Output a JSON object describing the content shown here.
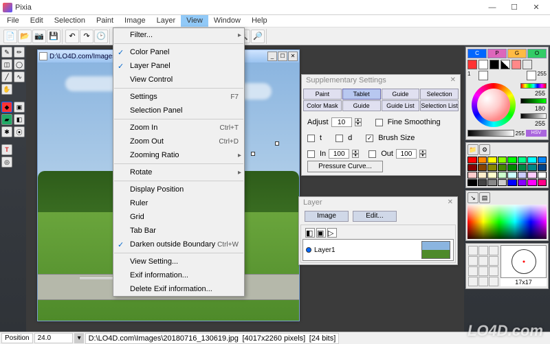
{
  "window": {
    "title": "Pixia",
    "min": "—",
    "max": "☐",
    "close": "✕"
  },
  "menubar": [
    "File",
    "Edit",
    "Selection",
    "Paint",
    "Image",
    "Layer",
    "View",
    "Window",
    "Help"
  ],
  "view_menu": {
    "filter": "Filter...",
    "color_panel": "Color Panel",
    "layer_panel": "Layer Panel",
    "view_control": "View Control",
    "settings": "Settings",
    "settings_shortcut": "F7",
    "selection_panel": "Selection Panel",
    "zoom_in": "Zoom In",
    "zoom_in_shortcut": "Ctrl+T",
    "zoom_out": "Zoom Out",
    "zoom_out_shortcut": "Ctrl+D",
    "zooming_ratio": "Zooming Ratio",
    "rotate": "Rotate",
    "display_position": "Display Position",
    "ruler": "Ruler",
    "grid": "Grid",
    "tab_bar": "Tab Bar",
    "darken_outside": "Darken outside Boundary",
    "darken_shortcut": "Ctrl+W",
    "view_setting": "View Setting...",
    "exif_info": "Exif information...",
    "delete_exif": "Delete Exif information..."
  },
  "document": {
    "title": "D:\\LO4D.com\\Images\\20180716_130619.jpg [4017x2260 pixels] [24 bits]",
    "doc_titlebar": "D:\\LO4D.com/Images/201807"
  },
  "supp": {
    "title": "Supplementary Settings",
    "tabs": [
      "Paint",
      "Tablet",
      "Guide History",
      "Selection History",
      "Color Mask",
      "Guide",
      "Guide List",
      "Selection List"
    ],
    "adjust_label": "Adjust",
    "adjust_value": "10",
    "fine_smoothing": "Fine Smoothing",
    "cb_t": "t",
    "cb_d": "d",
    "brush_size": "Brush Size",
    "cb_in": "In",
    "in_value": "100",
    "cb_out": "Out",
    "out_value": "100",
    "pressure_curve": "Pressure Curve..."
  },
  "layer": {
    "title": "Layer",
    "image_tab": "Image",
    "edit_tab": "Edit...",
    "layer_name": "Layer1"
  },
  "right": {
    "tabs": [
      "C",
      "P",
      "G",
      "O"
    ],
    "val_255a": "255",
    "val_255b": "255",
    "val_255c": "255",
    "val_180": "180",
    "val_255d": "255",
    "hsv_label": "HSV",
    "brush_size": "17x17"
  },
  "status": {
    "position_label": "Position",
    "zoom": "24.0",
    "filepath": "D:\\LO4D.com\\Images\\20180716_130619.jpg",
    "dims": "[4017x2260 pixels]",
    "bits": "[24 bits]"
  },
  "watermark": "LO4D.com"
}
